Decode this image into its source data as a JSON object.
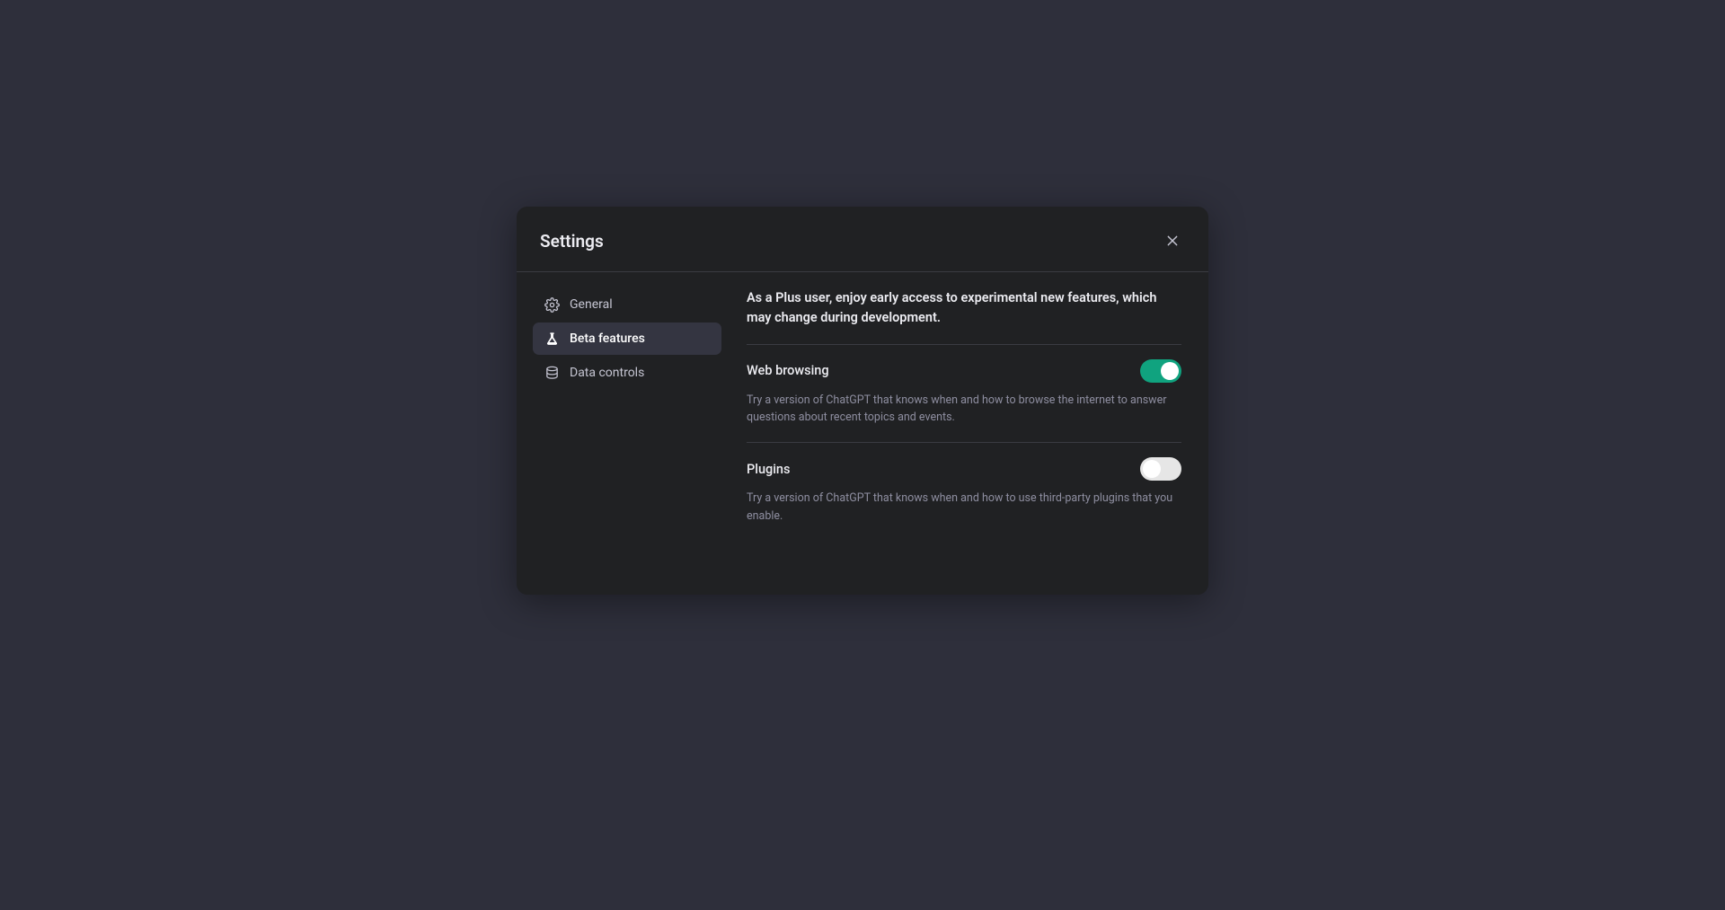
{
  "modal": {
    "title": "Settings"
  },
  "sidebar": {
    "items": [
      {
        "label": "General"
      },
      {
        "label": "Beta features"
      },
      {
        "label": "Data controls"
      }
    ]
  },
  "content": {
    "intro": "As a Plus user, enjoy early access to experimental new features, which may change during development.",
    "features": [
      {
        "title": "Web browsing",
        "desc": "Try a version of ChatGPT that knows when and how to browse the internet to answer questions about recent topics and events.",
        "enabled": true
      },
      {
        "title": "Plugins",
        "desc": "Try a version of ChatGPT that knows when and how to use third-party plugins that you enable.",
        "enabled": false
      }
    ]
  }
}
